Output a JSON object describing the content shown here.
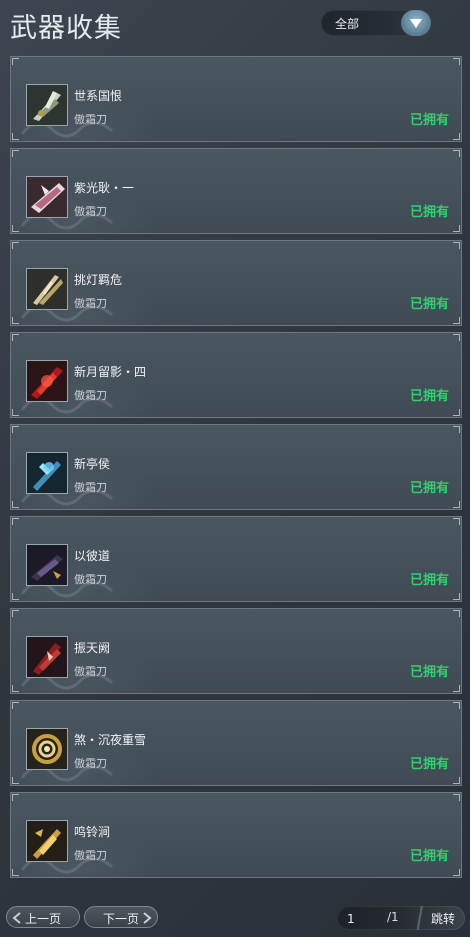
{
  "header": {
    "title": "武器收集",
    "filter_label": "全部"
  },
  "weapons": [
    {
      "name": "世系国恨",
      "type": "傲霜刀",
      "status": "已拥有",
      "icon": "weapon-icon-silver-dual-blade"
    },
    {
      "name": "紫光耿・一",
      "type": "傲霜刀",
      "status": "已拥有",
      "icon": "weapon-icon-pink-crystal-blade"
    },
    {
      "name": "挑灯羁危",
      "type": "傲霜刀",
      "status": "已拥有",
      "icon": "weapon-icon-gold-dual-blade"
    },
    {
      "name": "新月留影・四",
      "type": "傲霜刀",
      "status": "已拥有",
      "icon": "weapon-icon-red-flame-blade"
    },
    {
      "name": "新亭侯",
      "type": "傲霜刀",
      "status": "已拥有",
      "icon": "weapon-icon-blue-ice-blade"
    },
    {
      "name": "以彼道",
      "type": "傲霜刀",
      "status": "已拥有",
      "icon": "weapon-icon-dark-purple-blade"
    },
    {
      "name": "振天阙",
      "type": "傲霜刀",
      "status": "已拥有",
      "icon": "weapon-icon-crimson-blade"
    },
    {
      "name": "煞・沉夜重雪",
      "type": "傲霜刀",
      "status": "已拥有",
      "icon": "weapon-icon-gold-swirl-blade"
    },
    {
      "name": "鸣铃涧",
      "type": "傲霜刀",
      "status": "已拥有",
      "icon": "weapon-icon-gold-ornate-blade"
    }
  ],
  "pager": {
    "prev_label": "上一页",
    "next_label": "下一页",
    "current_page": "1",
    "total": "/1",
    "jump_label": "跳转"
  },
  "colors": {
    "owned_status": "#2fd06d",
    "card_border": "#6d7880",
    "background": "#2f373f"
  }
}
